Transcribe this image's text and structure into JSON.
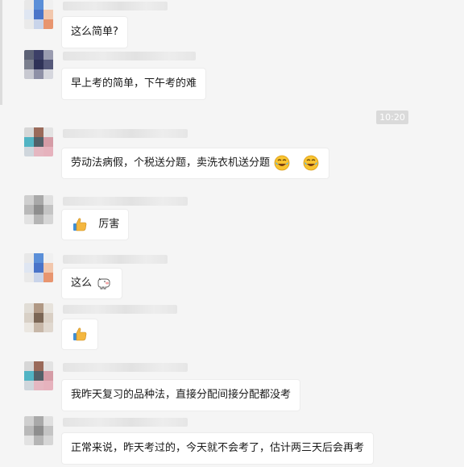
{
  "chat": {
    "timestamp": "10:20",
    "messages": [
      {
        "text": "这么简单?"
      },
      {
        "text": "早上考的简单，下午考的难"
      },
      {
        "text": "劳动法病假，个税送分题，卖洗衣机送分题",
        "emoji_after": [
          "laugh-cry-emoji",
          "laugh-cry-emoji"
        ]
      },
      {
        "text": "厉害",
        "emoji_before": "thumbs-up-emoji"
      },
      {
        "text": "这么",
        "emoji_after": [
          "cow-emoji"
        ]
      },
      {
        "text": "",
        "emoji_before": "thumbs-up-emoji"
      },
      {
        "text": "我昨天复习的品种法，直接分配间接分配都没考"
      },
      {
        "text": "正常来说，昨天考过的，今天就不会考了，估计两三天后会再考"
      }
    ]
  }
}
